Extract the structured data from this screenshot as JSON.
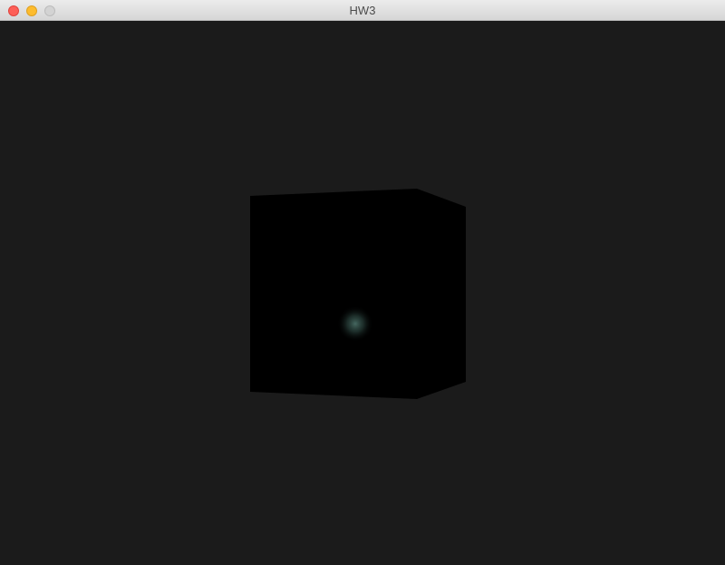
{
  "window": {
    "title": "HW3",
    "controls": {
      "close_color": "#fd5f57",
      "minimize_color": "#fdbc2e",
      "zoom_color": "#d3d3d3"
    }
  },
  "scene": {
    "background_color": "#1b1b1b",
    "object": "cube",
    "cube_color": "#000000",
    "highlight_color": "#4a6e66"
  }
}
